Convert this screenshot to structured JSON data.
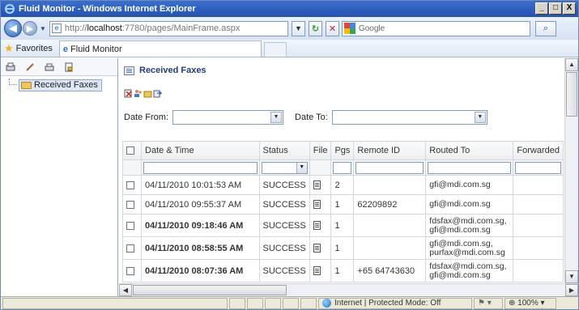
{
  "window": {
    "title": "Fluid Monitor - Windows Internet Explorer",
    "minimize": "_",
    "maximize": "□",
    "close": "X"
  },
  "address_bar": {
    "url_prefix": "http://",
    "url_host": "localhost",
    "url_rest": ":7780/pages/MainFrame.aspx",
    "search_placeholder": "Google"
  },
  "favorites_bar": {
    "favorites_label": "Favorites",
    "tab_label": "Fluid Monitor"
  },
  "tree": {
    "items": [
      {
        "label": "Received Faxes",
        "selected": true
      }
    ]
  },
  "main": {
    "title": "Received Faxes",
    "date_from_label": "Date From:",
    "date_to_label": "Date To:",
    "date_from_value": "",
    "date_to_value": ""
  },
  "grid": {
    "columns": [
      "Date & Time",
      "Status",
      "File",
      "Pgs",
      "Remote ID",
      "Routed To",
      "Forwarded"
    ],
    "rows": [
      {
        "date": "04/11/2010 10:01:53 AM",
        "bold": false,
        "status": "SUCCESS",
        "pgs": "2",
        "remote_id": "",
        "routed_to": [
          "gfi@mdi.com.sg"
        ],
        "forwarded": ""
      },
      {
        "date": "04/11/2010 09:55:37 AM",
        "bold": false,
        "status": "SUCCESS",
        "pgs": "1",
        "remote_id": "62209892",
        "routed_to": [
          "gfi@mdi.com.sg"
        ],
        "forwarded": ""
      },
      {
        "date": "04/11/2010 09:18:46 AM",
        "bold": true,
        "status": "SUCCESS",
        "pgs": "1",
        "remote_id": "",
        "routed_to": [
          "fdsfax@mdi.com.sg,",
          "gfi@mdi.com.sg"
        ],
        "forwarded": ""
      },
      {
        "date": "04/11/2010 08:58:55 AM",
        "bold": true,
        "status": "SUCCESS",
        "pgs": "1",
        "remote_id": "",
        "routed_to": [
          "gfi@mdi.com.sg,",
          "purfax@mdi.com.sg"
        ],
        "forwarded": ""
      },
      {
        "date": "04/11/2010 08:07:36 AM",
        "bold": true,
        "status": "SUCCESS",
        "pgs": "1",
        "remote_id": "+65 64743630",
        "routed_to": [
          "fdsfax@mdi.com.sg,",
          "gfi@mdi.com.sg"
        ],
        "forwarded": ""
      }
    ]
  },
  "status_bar": {
    "zone_text": "Internet | Protected Mode: Off",
    "zoom": "100%"
  },
  "colors": {
    "titlebar": "#2452b0",
    "link_bold": "#1f3d7a",
    "selection": "#dde7f6"
  }
}
